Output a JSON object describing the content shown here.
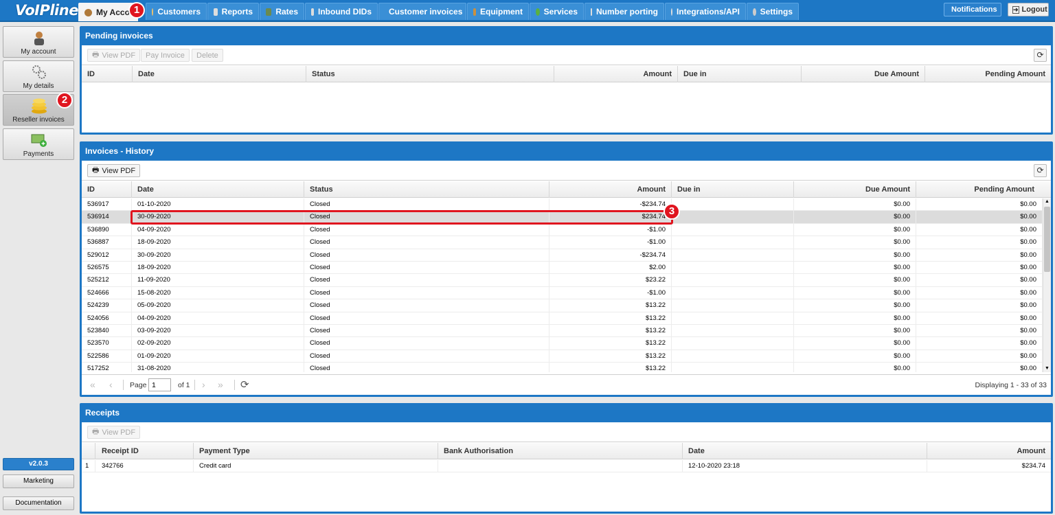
{
  "app": {
    "logo": "VoIPline"
  },
  "tabs": [
    {
      "label": "My Acco",
      "icon": "user-icon"
    },
    {
      "label": "Customers",
      "icon": "user-icon"
    },
    {
      "label": "Reports",
      "icon": "report-icon"
    },
    {
      "label": "Rates",
      "icon": "rates-icon"
    },
    {
      "label": "Inbound DIDs",
      "icon": "list-icon"
    },
    {
      "label": "Customer invoices",
      "icon": "coins-icon"
    },
    {
      "label": "Equipment",
      "icon": "box-icon"
    },
    {
      "label": "Services",
      "icon": "refresh-icon"
    },
    {
      "label": "Number porting",
      "icon": "phone-icon"
    },
    {
      "label": "Integrations/API",
      "icon": "gear-icon"
    },
    {
      "label": "Settings",
      "icon": "gears-icon"
    }
  ],
  "header_buttons": {
    "notifications": "Notifications",
    "logout": "Logout"
  },
  "sidebar": {
    "items": [
      {
        "label": "My account",
        "icon": "person-icon"
      },
      {
        "label": "My details",
        "icon": "gears-icon"
      },
      {
        "label": "Reseller invoices",
        "icon": "coins-icon"
      },
      {
        "label": "Payments",
        "icon": "money-icon"
      }
    ],
    "version": "v2.0.3",
    "marketing": "Marketing",
    "documentation": "Documentation"
  },
  "pending": {
    "title": "Pending invoices",
    "buttons": {
      "view_pdf": "View PDF",
      "pay_invoice": "Pay Invoice",
      "delete": "Delete"
    },
    "columns": [
      "ID",
      "Date",
      "Status",
      "Amount",
      "Due in",
      "Due Amount",
      "Pending Amount"
    ]
  },
  "history": {
    "title": "Invoices - History",
    "buttons": {
      "view_pdf": "View PDF"
    },
    "columns": [
      "ID",
      "Date",
      "Status",
      "Amount",
      "Due in",
      "Due Amount",
      "Pending Amount"
    ],
    "rows": [
      [
        "536917",
        "01-10-2020",
        "Closed",
        "-$234.74",
        "",
        "$0.00",
        "$0.00"
      ],
      [
        "536914",
        "30-09-2020",
        "Closed",
        "$234.74",
        "",
        "$0.00",
        "$0.00"
      ],
      [
        "536890",
        "04-09-2020",
        "Closed",
        "-$1.00",
        "",
        "$0.00",
        "$0.00"
      ],
      [
        "536887",
        "18-09-2020",
        "Closed",
        "-$1.00",
        "",
        "$0.00",
        "$0.00"
      ],
      [
        "529012",
        "30-09-2020",
        "Closed",
        "-$234.74",
        "",
        "$0.00",
        "$0.00"
      ],
      [
        "526575",
        "18-09-2020",
        "Closed",
        "$2.00",
        "",
        "$0.00",
        "$0.00"
      ],
      [
        "525212",
        "11-09-2020",
        "Closed",
        "$23.22",
        "",
        "$0.00",
        "$0.00"
      ],
      [
        "524666",
        "15-08-2020",
        "Closed",
        "-$1.00",
        "",
        "$0.00",
        "$0.00"
      ],
      [
        "524239",
        "05-09-2020",
        "Closed",
        "$13.22",
        "",
        "$0.00",
        "$0.00"
      ],
      [
        "524056",
        "04-09-2020",
        "Closed",
        "$13.22",
        "",
        "$0.00",
        "$0.00"
      ],
      [
        "523840",
        "03-09-2020",
        "Closed",
        "$13.22",
        "",
        "$0.00",
        "$0.00"
      ],
      [
        "523570",
        "02-09-2020",
        "Closed",
        "$13.22",
        "",
        "$0.00",
        "$0.00"
      ],
      [
        "522586",
        "01-09-2020",
        "Closed",
        "$13.22",
        "",
        "$0.00",
        "$0.00"
      ],
      [
        "517252",
        "31-08-2020",
        "Closed",
        "$13.22",
        "",
        "$0.00",
        "$0.00"
      ]
    ],
    "pager": {
      "page_label": "Page",
      "page_value": "1",
      "of_label": "of 1",
      "displaying": "Displaying 1 - 33 of 33"
    }
  },
  "receipts": {
    "title": "Receipts",
    "buttons": {
      "view_pdf": "View PDF"
    },
    "columns": [
      "Receipt ID",
      "Payment Type",
      "Bank Authorisation",
      "Date",
      "Amount"
    ],
    "rows": [
      [
        "1",
        "342766",
        "Credit card",
        "",
        "12-10-2020 23:18",
        "$234.74"
      ]
    ]
  },
  "markers": [
    "1",
    "2",
    "3"
  ],
  "colors": {
    "accent": "#1d77c5",
    "marker": "#e0151f"
  }
}
